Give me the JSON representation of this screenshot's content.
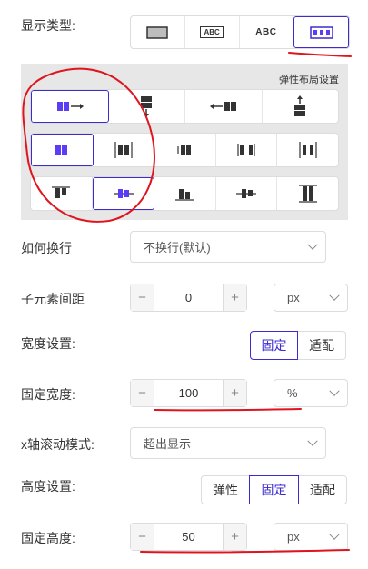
{
  "display_type": {
    "label": "显示类型:",
    "options": [
      {
        "icon": "block-rect-icon"
      },
      {
        "text": "ABC",
        "icon": "inline-block-abc-icon"
      },
      {
        "text": "ABC",
        "icon": "inline-text-abc-icon"
      },
      {
        "icon": "flex-layout-icon",
        "active": true
      }
    ]
  },
  "flex_panel": {
    "title": "弹性布局设置",
    "direction_options": [
      "flex-row-arrow-right-icon",
      "flex-column-arrow-down-icon",
      "flex-row-reverse-arrow-left-icon",
      "flex-column-reverse-arrow-up-icon"
    ],
    "justify_options": [
      "justify-start-icon",
      "justify-center-icon",
      "justify-end-icon",
      "justify-space-between-icon",
      "justify-space-around-icon"
    ],
    "align_options": [
      "align-start-icon",
      "align-center-icon",
      "align-end-icon",
      "align-baseline-icon",
      "align-stretch-icon"
    ]
  },
  "wrap": {
    "label": "如何换行",
    "value": "不换行(默认)"
  },
  "gap": {
    "label": "子元素间距",
    "value": "0",
    "unit": "px",
    "minus": "−",
    "plus": "+"
  },
  "width_setting": {
    "label": "宽度设置:",
    "options": [
      "固定",
      "适配"
    ],
    "active": "固定"
  },
  "fixed_width": {
    "label": "固定宽度:",
    "value": "100",
    "unit": "%",
    "minus": "−",
    "plus": "+"
  },
  "x_scroll": {
    "label": "x轴滚动模式:",
    "value": "超出显示"
  },
  "height_setting": {
    "label": "高度设置:",
    "options": [
      "弹性",
      "固定",
      "适配"
    ],
    "active": "固定"
  },
  "fixed_height": {
    "label": "固定高度:",
    "value": "50",
    "unit": "px",
    "minus": "−",
    "plus": "+"
  },
  "colors": {
    "accent": "#3b2bd1",
    "annotation": "#e0141e",
    "icon_purple": "#5b3df5"
  }
}
